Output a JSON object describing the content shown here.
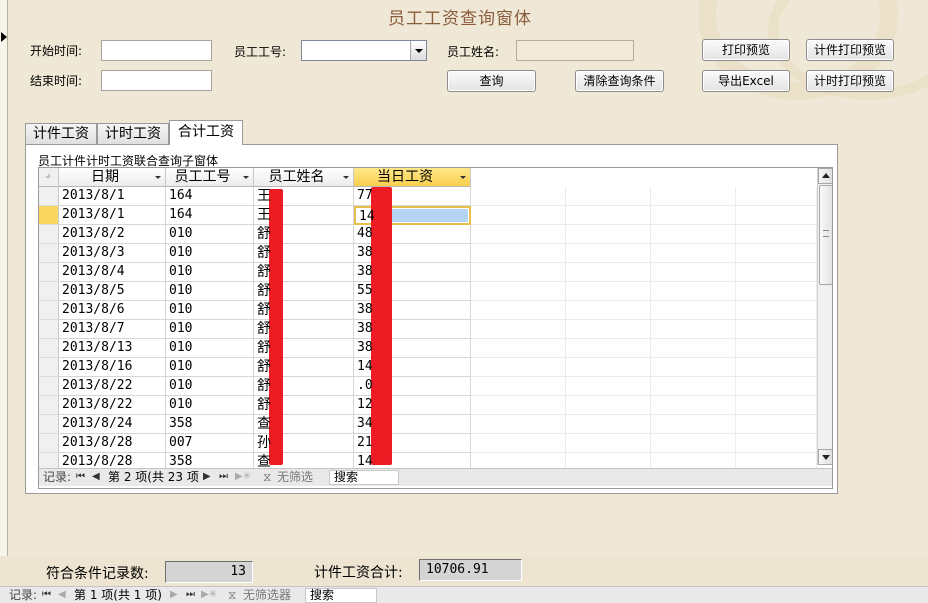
{
  "form": {
    "title": "员工工资查询窗体",
    "filters": {
      "start_time_label": "开始时间:",
      "end_time_label": "结束时间:",
      "employee_id_label": "员工工号:",
      "employee_name_label": "员工姓名:",
      "start_time_value": "",
      "end_time_value": "",
      "employee_id_value": "",
      "employee_name_value": ""
    },
    "buttons": {
      "print_preview": "打印预览",
      "piece_print_preview": "计件打印预览",
      "query": "查询",
      "clear_conditions": "清除查询条件",
      "export_excel": "导出Excel",
      "time_print_preview": "计时打印预览"
    },
    "tabs": [
      "计件工资",
      "计时工资",
      "合计工资"
    ],
    "active_tab": 2
  },
  "subform": {
    "caption": "员工计件计时工资联合查询子窗体",
    "columns": [
      "日期",
      "员工工号",
      "员工姓名",
      "当日工资"
    ],
    "rows": [
      {
        "date": "2013/8/1",
        "emp_id": "164",
        "name": "王",
        "wage": "77"
      },
      {
        "date": "2013/8/1",
        "emp_id": "164",
        "name": "王",
        "wage": "14"
      },
      {
        "date": "2013/8/2",
        "emp_id": "010",
        "name": "舒",
        "wage": "48"
      },
      {
        "date": "2013/8/3",
        "emp_id": "010",
        "name": "舒",
        "wage": "38"
      },
      {
        "date": "2013/8/4",
        "emp_id": "010",
        "name": "舒",
        "wage": "38"
      },
      {
        "date": "2013/8/5",
        "emp_id": "010",
        "name": "舒",
        "wage": "55"
      },
      {
        "date": "2013/8/6",
        "emp_id": "010",
        "name": "舒",
        "wage": "38"
      },
      {
        "date": "2013/8/7",
        "emp_id": "010",
        "name": "舒",
        "wage": "38"
      },
      {
        "date": "2013/8/13",
        "emp_id": "010",
        "name": "舒",
        "wage": "38"
      },
      {
        "date": "2013/8/16",
        "emp_id": "010",
        "name": "舒",
        "wage": "14"
      },
      {
        "date": "2013/8/22",
        "emp_id": "010",
        "name": "舒",
        "wage": ".0"
      },
      {
        "date": "2013/8/22",
        "emp_id": "010",
        "name": "舒",
        "wage": "12"
      },
      {
        "date": "2013/8/24",
        "emp_id": "358",
        "name": "查",
        "wage": "34"
      },
      {
        "date": "2013/8/28",
        "emp_id": "007",
        "name": "孙",
        "wage": "21"
      },
      {
        "date": "2013/8/28",
        "emp_id": "358",
        "name": "查",
        "wage": "14"
      }
    ],
    "current_row": 1,
    "nav": {
      "record_label": "记录:",
      "position": "第 2 项(共 23 项",
      "filter_label": "无筛选",
      "search_label": "搜索"
    }
  },
  "summary": {
    "count_label": "符合条件记录数:",
    "count_value": "13",
    "total_label": "计件工资合计:",
    "total_value": "10706.91"
  },
  "main_nav": {
    "record_label": "记录:",
    "position": "第 1 项(共 1 项)",
    "filter_label": "无筛选器",
    "search_label": "搜索"
  },
  "colors": {
    "form_background": "#efe8d6",
    "title_color": "#8a5c3c",
    "selected_header": "#f8cf4d",
    "redaction": "#ed1c24"
  }
}
